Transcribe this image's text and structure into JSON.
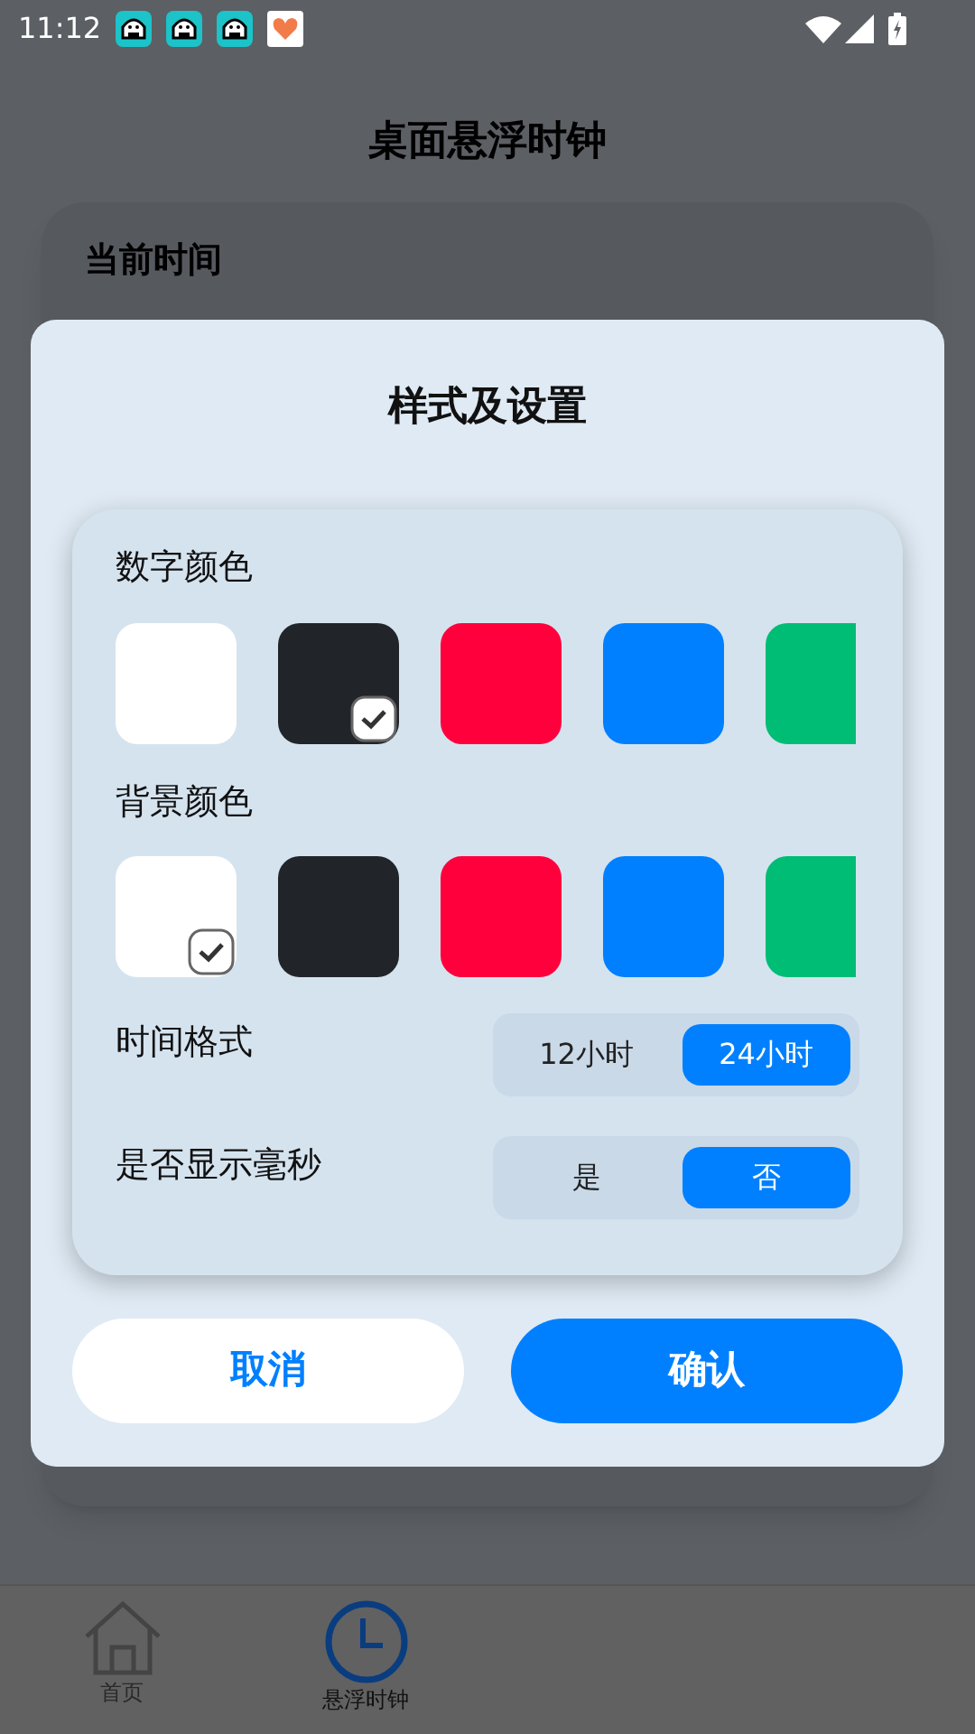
{
  "status_bar": {
    "time": "11:12",
    "notifications": [
      {
        "kind": "app"
      },
      {
        "kind": "app"
      },
      {
        "kind": "app"
      },
      {
        "kind": "heart"
      }
    ]
  },
  "page": {
    "title": "桌面悬浮时钟",
    "card_label": "当前时间"
  },
  "dialog": {
    "title": "样式及设置",
    "digit_color": {
      "label": "数字颜色",
      "swatches": [
        {
          "color": "#ffffff",
          "selected": false
        },
        {
          "color": "#212529",
          "selected": true
        },
        {
          "color": "#ff003c",
          "selected": false
        },
        {
          "color": "#0080ff",
          "selected": false
        },
        {
          "color": "#00bd75",
          "selected": false
        }
      ]
    },
    "background_color": {
      "label": "背景颜色",
      "swatches": [
        {
          "color": "#ffffff",
          "selected": true
        },
        {
          "color": "#212529",
          "selected": false
        },
        {
          "color": "#ff003c",
          "selected": false
        },
        {
          "color": "#0080ff",
          "selected": false
        },
        {
          "color": "#00bd75",
          "selected": false
        }
      ]
    },
    "time_format": {
      "label": "时间格式",
      "options": [
        {
          "label": "12小时",
          "selected": false
        },
        {
          "label": "24小时",
          "selected": true
        }
      ]
    },
    "show_milliseconds": {
      "label": "是否显示毫秒",
      "options": [
        {
          "label": "是",
          "selected": false
        },
        {
          "label": "否",
          "selected": true
        }
      ]
    },
    "buttons": [
      {
        "label": "取消",
        "kind": "cancel"
      },
      {
        "label": "确认",
        "kind": "confirm"
      }
    ]
  },
  "bottom_nav": [
    {
      "label": "首页",
      "kind": "home",
      "selected": false
    },
    {
      "label": "悬浮时钟",
      "kind": "clock",
      "selected": true
    }
  ]
}
